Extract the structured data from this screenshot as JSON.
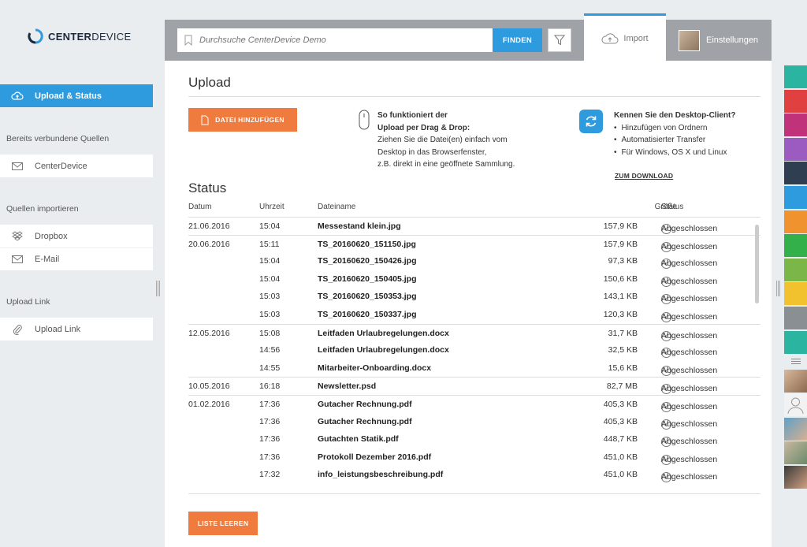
{
  "app": {
    "logo_bold": "CENTER",
    "logo_light": "DEVICE"
  },
  "sidebar": {
    "active_item": "Upload & Status",
    "section_connected": "Bereits verbundene Quellen",
    "connected_items": [
      "CenterDevice"
    ],
    "section_import": "Quellen importieren",
    "import_items": [
      "Dropbox",
      "E-Mail"
    ],
    "section_upload_link": "Upload Link",
    "upload_link_item": "Upload Link"
  },
  "topbar": {
    "search_placeholder": "Durchsuche CenterDevice Demo",
    "find_label": "FINDEN",
    "tab_import": "Import",
    "tab_settings": "Einstellungen"
  },
  "upload": {
    "title": "Upload",
    "add_file_label": "DATEI HINZUFÜGEN",
    "dragdrop_title_1": "So funktioniert der",
    "dragdrop_title_2": "Upload per Drag & Drop:",
    "dragdrop_line_1": "Ziehen Sie die Datei(en) einfach vom",
    "dragdrop_line_2": "Desktop in das Browserfenster,",
    "dragdrop_line_3": "z.B. direkt in eine geöffnete Sammlung.",
    "desktop_title": "Kennen Sie den Desktop-Client?",
    "desktop_bullets": [
      "Hinzufügen von Ordnern",
      "Automatisierter Transfer",
      "Für Windows, OS X und Linux"
    ],
    "download_link": "ZUM DOWNLOAD"
  },
  "status": {
    "title": "Status",
    "columns": {
      "date": "Datum",
      "time": "Uhrzeit",
      "file": "Dateiname",
      "size": "Größe",
      "status": "Status"
    },
    "rows": [
      {
        "date": "21.06.2016",
        "time": "15:04",
        "file": "Messestand klein.jpg",
        "size": "157,9 KB",
        "status": "Abgeschlossen"
      },
      {
        "date": "20.06.2016",
        "time": "15:11",
        "file": "TS_20160620_151150.jpg",
        "size": "157,9 KB",
        "status": "Abgeschlossen"
      },
      {
        "date": "",
        "time": "15:04",
        "file": "TS_20160620_150426.jpg",
        "size": "97,3 KB",
        "status": "Abgeschlossen"
      },
      {
        "date": "",
        "time": "15:04",
        "file": "TS_20160620_150405.jpg",
        "size": "150,6 KB",
        "status": "Abgeschlossen"
      },
      {
        "date": "",
        "time": "15:03",
        "file": "TS_20160620_150353.jpg",
        "size": "143,1 KB",
        "status": "Abgeschlossen"
      },
      {
        "date": "",
        "time": "15:03",
        "file": "TS_20160620_150337.jpg",
        "size": "120,3 KB",
        "status": "Abgeschlossen"
      },
      {
        "date": "12.05.2016",
        "time": "15:08",
        "file": "Leitfaden Urlaubregelungen.docx",
        "size": "31,7 KB",
        "status": "Abgeschlossen"
      },
      {
        "date": "",
        "time": "14:56",
        "file": "Leitfaden Urlaubregelungen.docx",
        "size": "32,5 KB",
        "status": "Abgeschlossen"
      },
      {
        "date": "",
        "time": "14:55",
        "file": "Mitarbeiter-Onboarding.docx",
        "size": "15,6 KB",
        "status": "Abgeschlossen"
      },
      {
        "date": "10.05.2016",
        "time": "16:18",
        "file": "Newsletter.psd",
        "size": "82,7 MB",
        "status": "Abgeschlossen"
      },
      {
        "date": "01.02.2016",
        "time": "17:36",
        "file": "Gutacher Rechnung.pdf",
        "size": "405,3 KB",
        "status": "Abgeschlossen"
      },
      {
        "date": "",
        "time": "17:36",
        "file": "Gutacher Rechnung.pdf",
        "size": "405,3 KB",
        "status": "Abgeschlossen"
      },
      {
        "date": "",
        "time": "17:36",
        "file": "Gutachten Statik.pdf",
        "size": "448,7 KB",
        "status": "Abgeschlossen"
      },
      {
        "date": "",
        "time": "17:36",
        "file": "Protokoll Dezember 2016.pdf",
        "size": "451,0 KB",
        "status": "Abgeschlossen"
      },
      {
        "date": "",
        "time": "17:32",
        "file": "info_leistungsbeschreibung.pdf",
        "size": "451,0 KB",
        "status": "Abgeschlossen"
      }
    ],
    "clear_label": "LISTE LEEREN"
  },
  "right_strip": {
    "colors": [
      "#2bb5a0",
      "#e04040",
      "#c0337a",
      "#9b5bc0",
      "#2f3e50",
      "#2e9bde",
      "#f0922e",
      "#34b04a",
      "#7ab648",
      "#f2c12e",
      "#8a8f94",
      "#2bb5a0"
    ]
  },
  "colors": {
    "accent": "#2e9bde",
    "orange": "#f07b3f"
  }
}
